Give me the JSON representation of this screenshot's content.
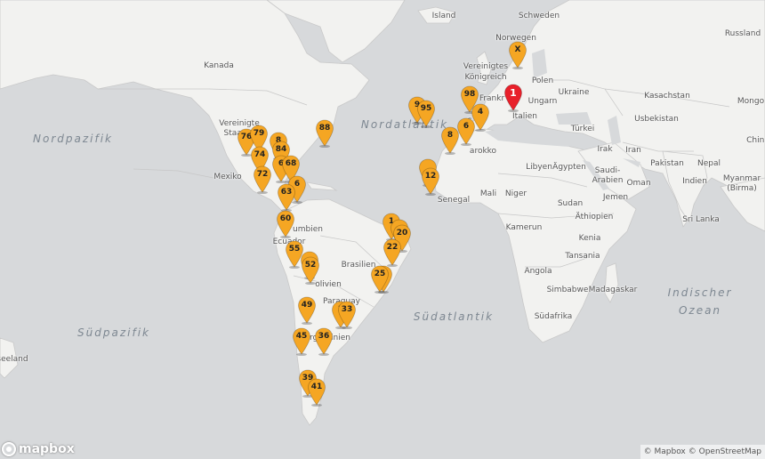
{
  "map": {
    "attribution": {
      "mapbox": "© Mapbox",
      "osm": "© OpenStreetMap"
    },
    "logo_text": "mapbox",
    "oceans": {
      "nordpazifik": "Nordpazifik",
      "nordatlantik": "Nordatlantik",
      "suedatlantik": "Südatlantik",
      "suedpazifik": "Südpazifik",
      "indischer_1": "Indischer",
      "indischer_2": "Ozean"
    },
    "labels": {
      "island": "Island",
      "schweden": "Schweden",
      "norwegen": "Norwegen",
      "russland": "Russland",
      "kanada": "Kanada",
      "vk_1": "Vereinigtes",
      "vk_2": "Königreich",
      "polen": "Polen",
      "ukraine": "Ukraine",
      "kasachstan": "Kasachstan",
      "mongolei": "Mongo",
      "ungarn": "Ungarn",
      "frankreich": "Frankr",
      "italien": "Italien",
      "usbekistan": "Usbekistan",
      "spanien": "S",
      "tuerkei": "Türkei",
      "vs_1": "Vereinigte",
      "vs_2": "Staaten",
      "marokko": "arokko",
      "irak": "Irak",
      "iran": "Iran",
      "china": "China",
      "libyen": "Libyen",
      "aegypten": "Ägypten",
      "pakistan": "Pakistan",
      "nepal": "Nepal",
      "sa_1": "Saudi-",
      "sa_2": "Arabien",
      "mexiko": "Mexiko",
      "oman": "Oman",
      "indien": "Indien",
      "myanmar_1": "Myanmar",
      "myanmar_2": "(Birma)",
      "mali": "Mali",
      "niger": "Niger",
      "senegal": "Senegal",
      "jemen": "Jemen",
      "sudan": "Sudan",
      "aethiopien": "Äthiopien",
      "srilanka": "Sri Lanka",
      "kolumbien": "umbien",
      "ecuador": "Ecuador",
      "kamerun": "Kamerun",
      "kenia": "Kenia",
      "tansania": "Tansania",
      "brasilien": "Brasilien",
      "angola": "Angola",
      "bolivien": "olivien",
      "simbabwe": "Simbabwe",
      "madagaskar": "Madagaskar",
      "paraguay": "Paraguay",
      "suedafrika": "Südafrika",
      "argentinien": "rgentinien",
      "neuseeland": "seeland"
    },
    "markers": [
      {
        "label": "1",
        "color": "#e8202a"
      },
      {
        "label": "X",
        "color": "#f5a623"
      },
      {
        "label": "98",
        "color": "#f5a623"
      },
      {
        "label": "4",
        "color": "#f5a623"
      },
      {
        "label": "9",
        "color": "#f5a623"
      },
      {
        "label": "95",
        "color": "#f5a623"
      },
      {
        "label": "6",
        "color": "#f5a623"
      },
      {
        "label": "8",
        "color": "#f5a623"
      },
      {
        "label": "",
        "color": "#f5a623"
      },
      {
        "label": "12",
        "color": "#f5a623"
      },
      {
        "label": "88",
        "color": "#f5a623"
      },
      {
        "label": "76",
        "color": "#f5a623"
      },
      {
        "label": "79",
        "color": "#f5a623"
      },
      {
        "label": "8",
        "color": "#f5a623"
      },
      {
        "label": "84",
        "color": "#f5a623"
      },
      {
        "label": "74",
        "color": "#f5a623"
      },
      {
        "label": "6",
        "color": "#f5a623"
      },
      {
        "label": "68",
        "color": "#f5a623"
      },
      {
        "label": "72",
        "color": "#f5a623"
      },
      {
        "label": "6",
        "color": "#f5a623"
      },
      {
        "label": "63",
        "color": "#f5a623"
      },
      {
        "label": "60",
        "color": "#f5a623"
      },
      {
        "label": "55",
        "color": "#f5a623"
      },
      {
        "label": "",
        "color": "#f5a623"
      },
      {
        "label": "52",
        "color": "#f5a623"
      },
      {
        "label": "49",
        "color": "#f5a623"
      },
      {
        "label": "3",
        "color": "#f5a623"
      },
      {
        "label": "33",
        "color": "#f5a623"
      },
      {
        "label": "45",
        "color": "#f5a623"
      },
      {
        "label": "36",
        "color": "#f5a623"
      },
      {
        "label": "39",
        "color": "#f5a623"
      },
      {
        "label": "41",
        "color": "#f5a623"
      },
      {
        "label": "1",
        "color": "#f5a623"
      },
      {
        "label": "",
        "color": "#f5a623"
      },
      {
        "label": "20",
        "color": "#f5a623"
      },
      {
        "label": "22",
        "color": "#f5a623"
      },
      {
        "label": "",
        "color": "#f5a623"
      },
      {
        "label": "25",
        "color": "#f5a623"
      }
    ]
  }
}
